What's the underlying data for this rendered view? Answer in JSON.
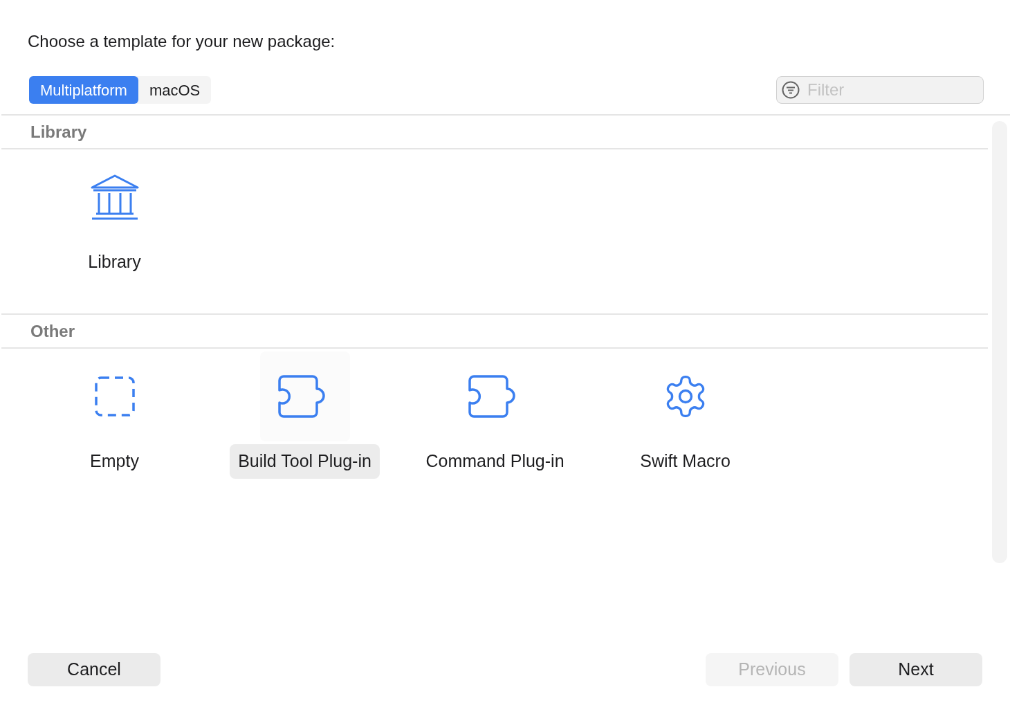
{
  "heading": "Choose a template for your new package:",
  "platform_tabs": [
    {
      "label": "Multiplatform",
      "selected": true
    },
    {
      "label": "macOS",
      "selected": false
    }
  ],
  "filter": {
    "placeholder": "Filter"
  },
  "sections": [
    {
      "title": "Library",
      "templates": [
        {
          "label": "Library",
          "kind": "library",
          "selected": false
        }
      ]
    },
    {
      "title": "Other",
      "templates": [
        {
          "label": "Empty",
          "kind": "empty",
          "selected": false
        },
        {
          "label": "Build Tool Plug-in",
          "kind": "plugin",
          "selected": true
        },
        {
          "label": "Command Plug-in",
          "kind": "plugin",
          "selected": false
        },
        {
          "label": "Swift Macro",
          "kind": "gear",
          "selected": false
        }
      ]
    }
  ],
  "buttons": [
    {
      "label": "Cancel",
      "disabled": false
    },
    {
      "label": "Previous",
      "disabled": true
    },
    {
      "label": "Next",
      "disabled": false
    }
  ]
}
